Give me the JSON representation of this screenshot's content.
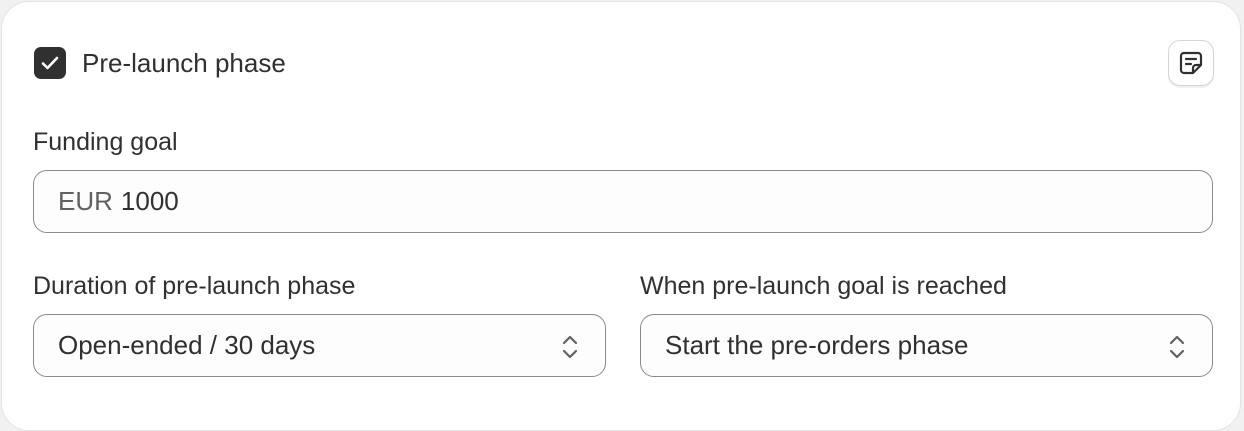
{
  "prelaunch": {
    "checkbox_checked": true,
    "title": "Pre-launch phase",
    "note_icon": "note-icon"
  },
  "funding": {
    "label": "Funding goal",
    "currency": "EUR",
    "amount": "1000"
  },
  "duration": {
    "label": "Duration of pre-launch phase",
    "selected": "Open-ended / 30 days"
  },
  "goal_reached": {
    "label": "When pre-launch goal is reached",
    "selected": "Start the pre-orders phase"
  },
  "colors": {
    "checkbox_fill": "#303030",
    "border": "#8a8a8a",
    "text": "#303030",
    "muted_text": "#616161"
  }
}
